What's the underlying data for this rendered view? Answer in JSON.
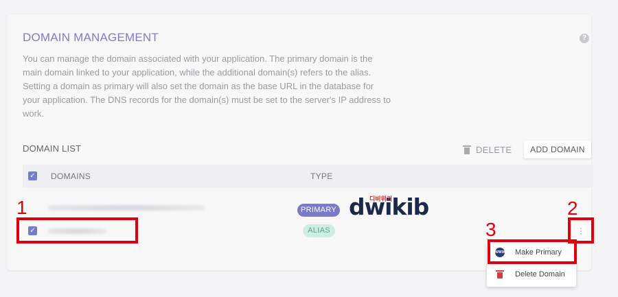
{
  "section": {
    "title": "DOMAIN MANAGEMENT",
    "help_icon": "?",
    "description": "You can manage the domain associated with your application. The primary domain is the main domain linked to your application, while the additional domain(s) refers to the alias. Setting a domain as primary will also set the domain as the base URL in the database for your application. The DNS records for the domain(s) must be set to the server's IP address to work."
  },
  "domain_list": {
    "title": "DOMAIN LIST",
    "delete_label": "DELETE",
    "add_label": "ADD DOMAIN",
    "columns": [
      "DOMAINS",
      "TYPE"
    ],
    "rows": [
      {
        "domain": "",
        "type": "PRIMARY",
        "checked": false
      },
      {
        "domain": "",
        "type": "ALIAS",
        "checked": true
      }
    ]
  },
  "row_menu": {
    "kebab": "⋮",
    "items": [
      {
        "label": "Make Primary",
        "icon": "www-icon"
      },
      {
        "label": "Delete Domain",
        "icon": "trash-icon"
      }
    ]
  },
  "annotations": {
    "step1": "1",
    "step2": "2",
    "step3": "3",
    "color": "#e0000b"
  },
  "watermark": {
    "text": "dwikib",
    "small": "디비위키"
  },
  "colors": {
    "accent": "#7b7ac8",
    "alias_bg": "#cdeee3",
    "alias_text": "#5f9f8a"
  }
}
